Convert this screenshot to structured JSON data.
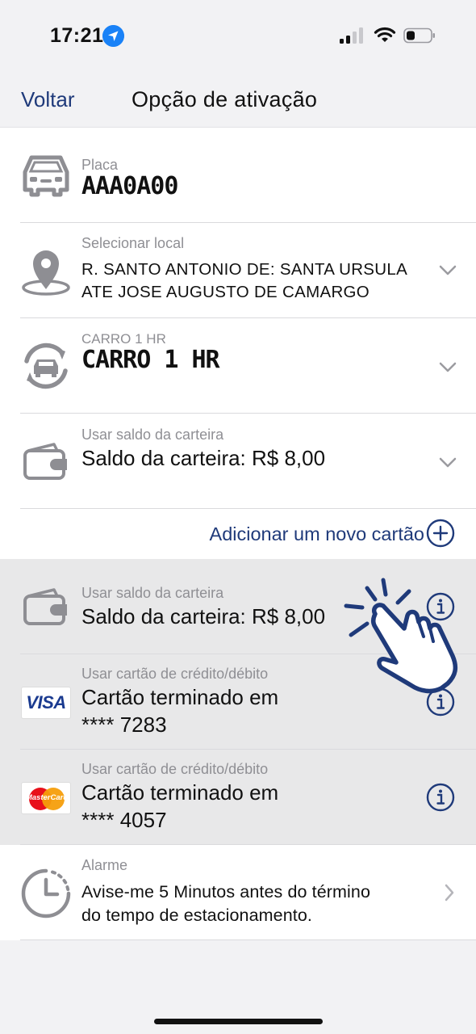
{
  "status": {
    "time": "17:21"
  },
  "nav": {
    "back_label": "Voltar",
    "title": "Opção de ativação"
  },
  "plate": {
    "label": "Placa",
    "value": "AAA0A00",
    "icon": "car-icon"
  },
  "location": {
    "label": "Selecionar local",
    "line1": "R. SANTO ANTONIO DE: SANTA URSULA",
    "line2": "ATE JOSE AUGUSTO DE CAMARGO",
    "icon": "map-pin-icon"
  },
  "rate": {
    "label": "CARRO 1 HR",
    "value": "CARRO 1 HR",
    "icon": "car-refresh-icon"
  },
  "payment_selected": {
    "label": "Usar saldo da carteira",
    "value": "Saldo da carteira: R$ 8,00",
    "icon": "wallet-icon"
  },
  "add_card": {
    "label": "Adicionar um novo cartão"
  },
  "payment_options": [
    {
      "label": "Usar saldo da carteira",
      "value": "Saldo da carteira: R$ 8,00",
      "icon": "wallet-icon"
    },
    {
      "label": "Usar cartão de crédito/débito",
      "line1": "Cartão terminado em",
      "line2": "**** 7283",
      "brand": "VISA",
      "icon": "visa-logo-icon"
    },
    {
      "label": "Usar cartão de crédito/débito",
      "line1": "Cartão terminado em",
      "line2": "**** 4057",
      "brand": "MasterCard",
      "icon": "mastercard-logo-icon"
    }
  ],
  "alarm": {
    "label": "Alarme",
    "line1": "Avise-me 5 Minutos antes do término",
    "line2": "do tempo de estacionamento.",
    "icon": "clock-timer-icon"
  },
  "colors": {
    "accent": "#1f3a7a",
    "row_bg": "#ffffff",
    "options_bg": "#e8e8e9",
    "page_bg": "#f2f2f4",
    "label_gray": "#8f8f94",
    "icon_gray": "#8e8e93"
  }
}
